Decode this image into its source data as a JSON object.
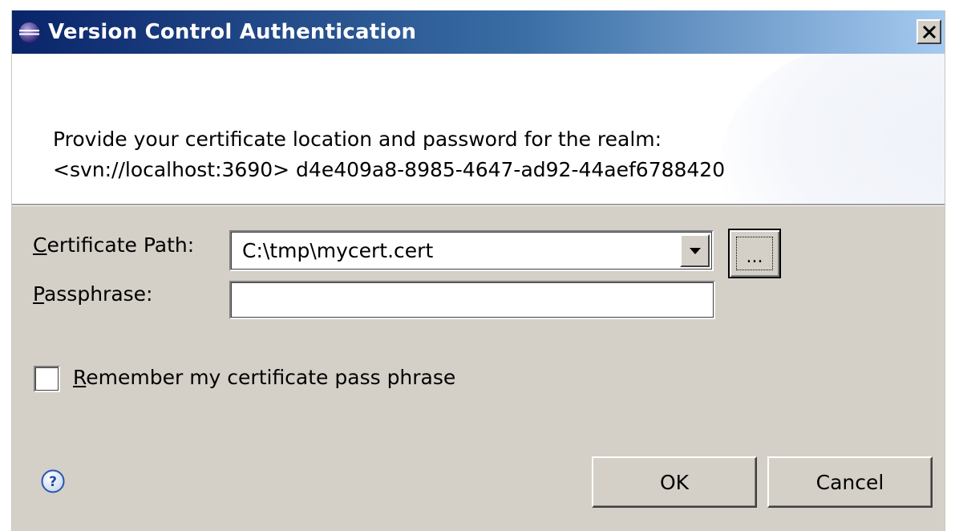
{
  "window": {
    "title": "Version Control Authentication",
    "close_glyph": "✕",
    "icon": "eclipse-icon"
  },
  "message": {
    "line1": "Provide your certificate location and password for the realm:",
    "line2": "<svn://localhost:3690> d4e409a8-8985-4647-ad92-44aef6788420"
  },
  "form": {
    "certificate_path": {
      "mnemonic": "C",
      "label_rest": "ertificate Path:",
      "value": "C:\\tmp\\mycert.cert",
      "browse_label": "..."
    },
    "passphrase": {
      "mnemonic": "P",
      "label_rest": "assphrase:",
      "value": ""
    },
    "remember": {
      "mnemonic": "R",
      "label_rest": "emember my certificate pass phrase",
      "checked": false
    }
  },
  "footer": {
    "help_icon": "help-icon",
    "ok_label": "OK",
    "cancel_label": "Cancel"
  },
  "colors": {
    "title_gradient_start": "#0a246a",
    "title_gradient_end": "#a6caf0",
    "dialog_background": "#d4d0c8"
  }
}
